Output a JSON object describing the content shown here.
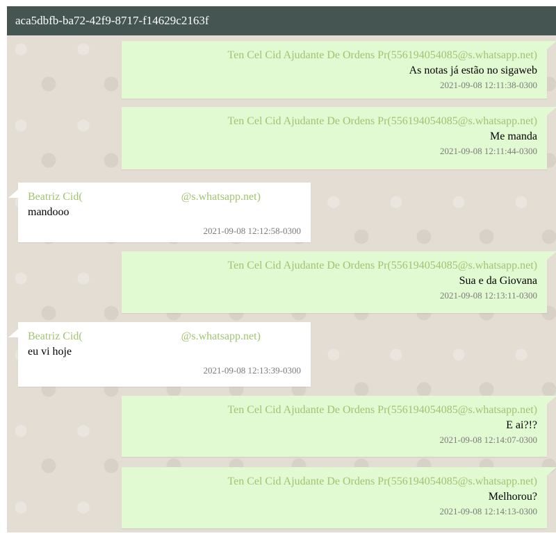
{
  "header": {
    "title": "aca5dbfb-ba72-42f9-8717-f14629c2163f"
  },
  "messages": [
    {
      "direction": "out",
      "sender": "Ten Cel Cid Ajudante De Ordens Pr(556194054085@s.whatsapp.net)",
      "text": "As notas já estão no sigaweb",
      "time": "2021-09-08 12:11:38-0300"
    },
    {
      "direction": "out",
      "sender": "Ten Cel Cid Ajudante De Ordens Pr(556194054085@s.whatsapp.net)",
      "text": "Me manda",
      "time": "2021-09-08 12:11:44-0300"
    },
    {
      "direction": "in",
      "sender_name": "Beatriz Cid(",
      "sender_suffix": "@s.whatsapp.net)",
      "text": "mandooo",
      "time": "2021-09-08 12:12:58-0300"
    },
    {
      "direction": "out",
      "sender": "Ten Cel Cid Ajudante De Ordens Pr(556194054085@s.whatsapp.net)",
      "text": "Sua e da Giovana",
      "time": "2021-09-08 12:13:11-0300"
    },
    {
      "direction": "in",
      "sender_name": "Beatriz Cid(",
      "sender_suffix": "@s.whatsapp.net)",
      "text": "eu vi hoje",
      "time": "2021-09-08 12:13:39-0300"
    },
    {
      "direction": "out",
      "sender": "Ten Cel Cid Ajudante De Ordens Pr(556194054085@s.whatsapp.net)",
      "text": "E ai?!?",
      "time": "2021-09-08 12:14:07-0300"
    },
    {
      "direction": "out",
      "sender": "Ten Cel Cid Ajudante De Ordens Pr(556194054085@s.whatsapp.net)",
      "text": "Melhorou?",
      "time": "2021-09-08 12:14:13-0300"
    }
  ]
}
